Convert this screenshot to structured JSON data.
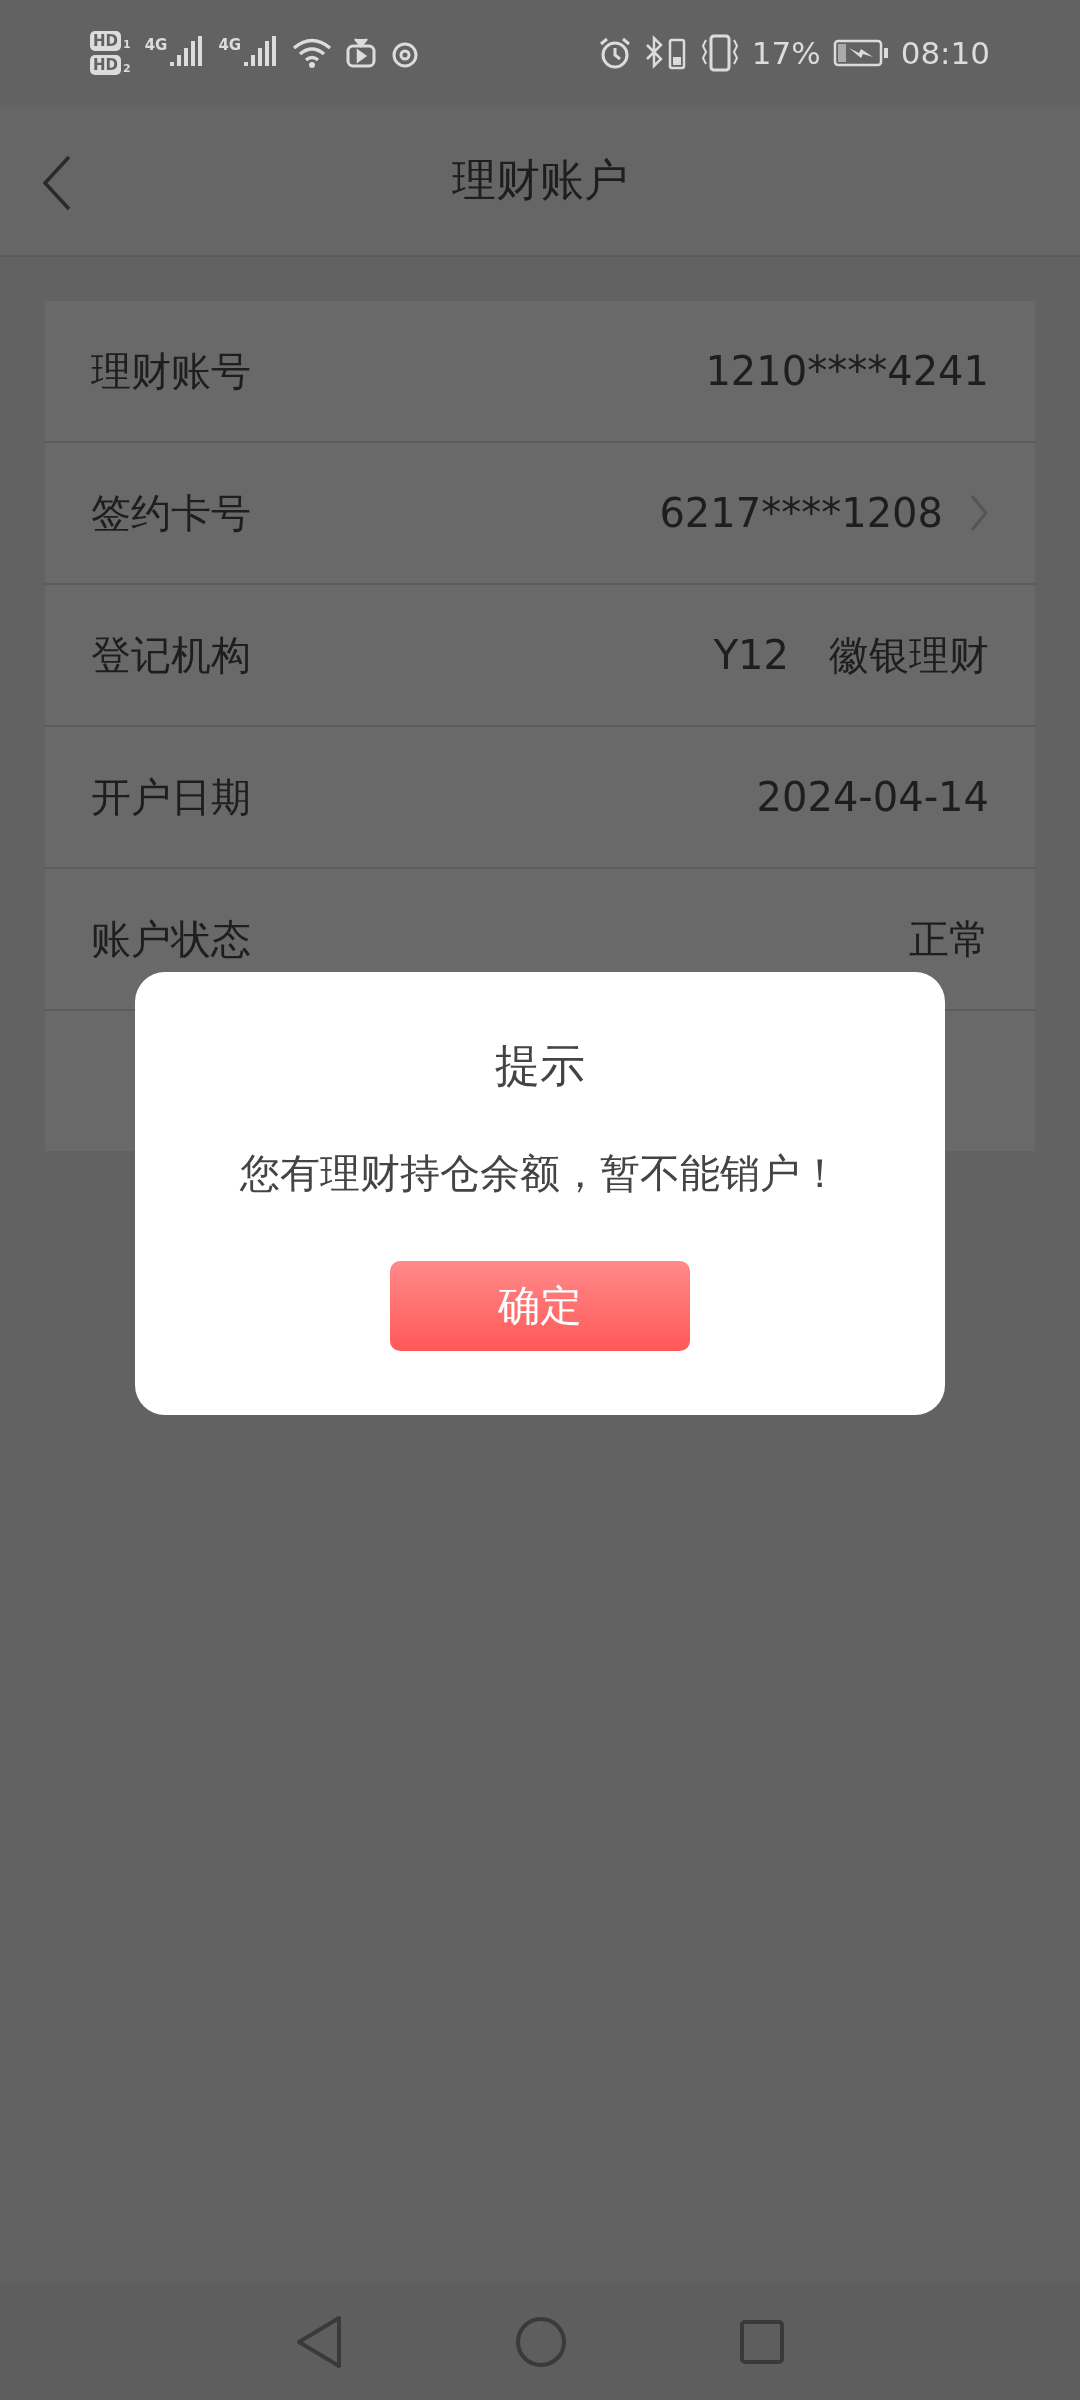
{
  "status_bar": {
    "sims": [
      {
        "badge": "HD",
        "slot": "1"
      },
      {
        "badge": "HD",
        "slot": "2"
      }
    ],
    "networks": [
      {
        "label": "4G"
      },
      {
        "label": "4G"
      }
    ],
    "battery_percent": "17%",
    "time": "08:10"
  },
  "header": {
    "title": "理财账户"
  },
  "rows": [
    {
      "label": "理财账号",
      "value": "1210****4241",
      "kind": "plain"
    },
    {
      "label": "签约卡号",
      "value": "6217****1208",
      "kind": "link"
    },
    {
      "label": "登记机构",
      "value": "Y12　徽银理财",
      "kind": "plain"
    },
    {
      "label": "开户日期",
      "value": "2024-04-14",
      "kind": "plain"
    },
    {
      "label": "账户状态",
      "value": "正常",
      "kind": "plain"
    }
  ],
  "dialog": {
    "title": "提示",
    "message": "您有理财持仓余额，暂不能销户！",
    "button": "确定"
  }
}
